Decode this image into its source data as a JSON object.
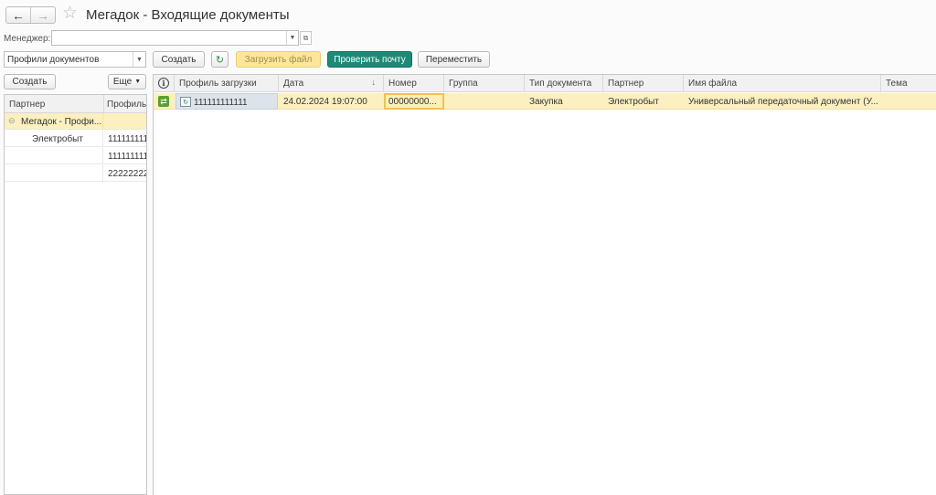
{
  "title": "Мегадок - Входящие документы",
  "manager": {
    "label": "Менеджер:",
    "value": ""
  },
  "toolbar": {
    "profile_select": "Профили документов",
    "create": "Создать",
    "load_file": "Загрузить файл",
    "check_mail": "Проверить почту",
    "move": "Переместить"
  },
  "left": {
    "create": "Создать",
    "more": "Еще",
    "columns": [
      "Партнер",
      "Профиль"
    ],
    "rows": [
      {
        "partner": "Мегадок - Профи...",
        "profile": ""
      },
      {
        "partner": "Электробыт",
        "profile": "111111111"
      },
      {
        "partner": "",
        "profile": "111111111"
      },
      {
        "partner": "",
        "profile": "222222222"
      }
    ]
  },
  "grid": {
    "columns": {
      "info": "",
      "profile": "Профиль загрузки",
      "date": "Дата",
      "number": "Номер",
      "group": "Группа",
      "doc_type": "Тип документа",
      "partner": "Партнер",
      "file_name": "Имя файла",
      "subject": "Тема"
    },
    "rows": [
      {
        "profile": "111111111111",
        "date": "24.02.2024 19:07:00",
        "number": "00000000...",
        "group": "",
        "doc_type": "Закупка",
        "partner": "Электробыт",
        "file_name": "Универсальный передаточный документ (У...",
        "subject": ""
      }
    ]
  },
  "colors": {
    "accent_green": "#1d8a77",
    "highlight_yellow": "#fcefc0",
    "load_button_yellow": "#fbe69a"
  }
}
